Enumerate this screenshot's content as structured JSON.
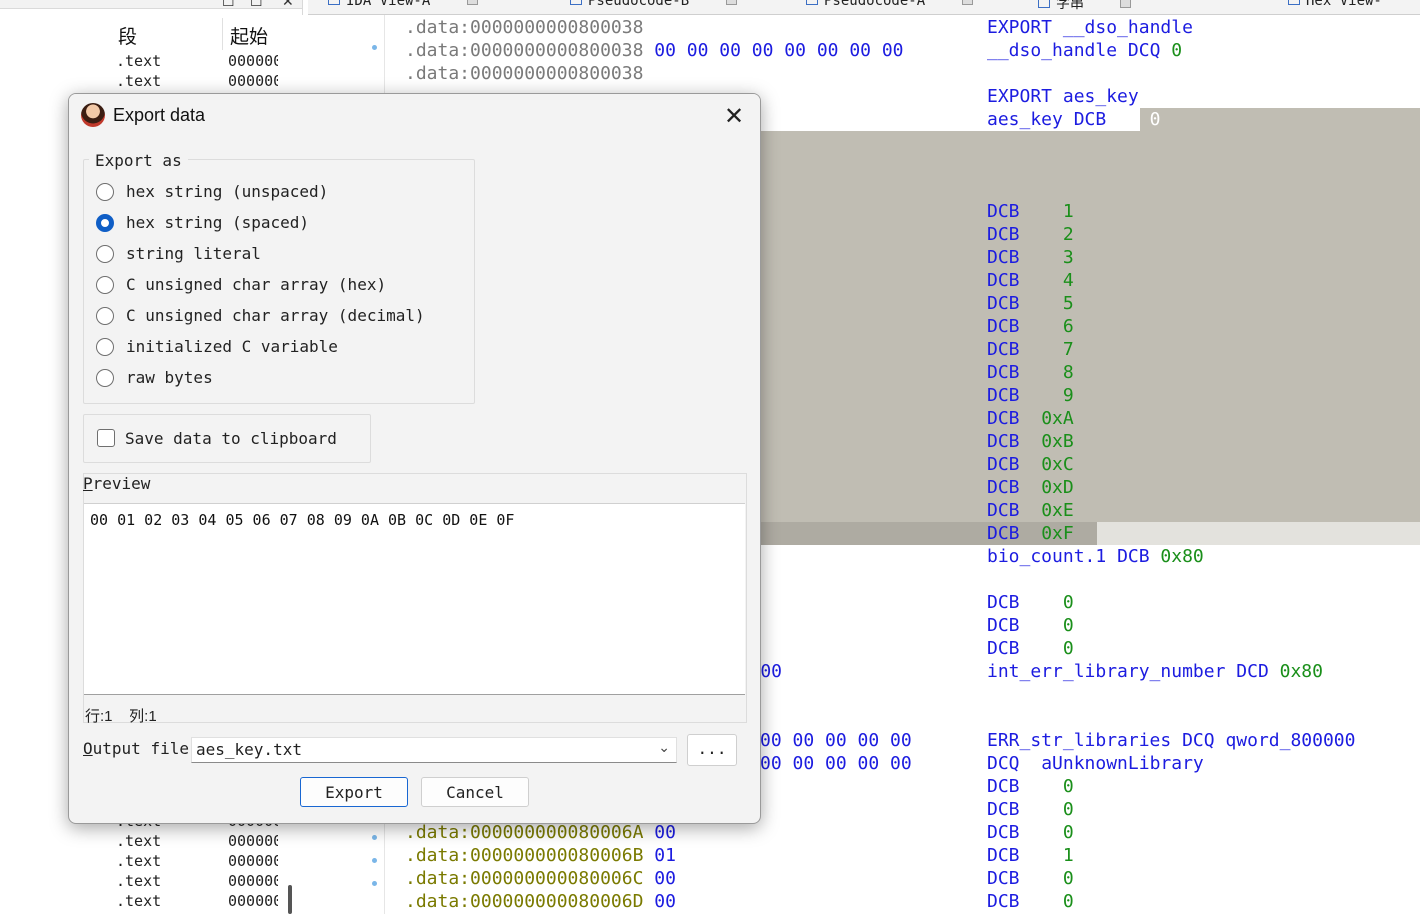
{
  "segments": {
    "headers": [
      "段",
      "起始"
    ],
    "rows_top": [
      {
        "name": ".text",
        "start": "000000"
      },
      {
        "name": ".text",
        "start": "000000"
      }
    ],
    "rows_bottom": [
      {
        "name": ".text",
        "start": "000000"
      },
      {
        "name": ".text",
        "start": "000000"
      },
      {
        "name": ".text",
        "start": "000000"
      },
      {
        "name": ".text",
        "start": "000000"
      },
      {
        "name": ".text",
        "start": "000000"
      }
    ]
  },
  "tabs": [
    {
      "label": "IDA View-A"
    },
    {
      "label": "Pseudocode-B"
    },
    {
      "label": "Pseudocode-A"
    },
    {
      "label": "字串"
    },
    {
      "label": "Hex View-"
    }
  ],
  "listing": {
    "left_top": [
      {
        "addr": ".data:0000000000800038",
        "bytes": ""
      },
      {
        "addr": ".data:0000000000800038",
        "bytes": "00 00 00 00 00 00 00 00"
      },
      {
        "addr": ".data:0000000000800038",
        "bytes": ""
      }
    ],
    "left_mid": [
      {
        "bytes": "00"
      },
      {
        "bytes": "00 00 00 00 00"
      },
      {
        "bytes": "00 00 00 00 00"
      }
    ],
    "left_bottom": [
      {
        "addr": ".data:000000000080006A",
        "bytes": "00"
      },
      {
        "addr": ".data:000000000080006B",
        "bytes": "01"
      },
      {
        "addr": ".data:000000000080006C",
        "bytes": "00"
      },
      {
        "addr": ".data:000000000080006D",
        "bytes": "00"
      }
    ],
    "right": [
      {
        "a": "EXPORT",
        "b": "__dso_handle",
        "c": ""
      },
      {
        "a": "__dso_handle",
        "b": "DCQ",
        "c": "0"
      },
      {
        "a": "",
        "b": "",
        "c": ""
      },
      {
        "a": "EXPORT",
        "b": "aes_key",
        "c": ""
      },
      {
        "a": "aes_key",
        "b": "DCB",
        "c": "0"
      },
      {
        "a": "",
        "b": "",
        "c": ""
      },
      {
        "a": "",
        "b": "",
        "c": ""
      },
      {
        "a": "",
        "b": "",
        "c": ""
      },
      {
        "a": "",
        "b": "DCB",
        "c": "1"
      },
      {
        "a": "",
        "b": "DCB",
        "c": "2"
      },
      {
        "a": "",
        "b": "DCB",
        "c": "3"
      },
      {
        "a": "",
        "b": "DCB",
        "c": "4"
      },
      {
        "a": "",
        "b": "DCB",
        "c": "5"
      },
      {
        "a": "",
        "b": "DCB",
        "c": "6"
      },
      {
        "a": "",
        "b": "DCB",
        "c": "7"
      },
      {
        "a": "",
        "b": "DCB",
        "c": "8"
      },
      {
        "a": "",
        "b": "DCB",
        "c": "9"
      },
      {
        "a": "",
        "b": "DCB",
        "c": "0xA"
      },
      {
        "a": "",
        "b": "DCB",
        "c": "0xB"
      },
      {
        "a": "",
        "b": "DCB",
        "c": "0xC"
      },
      {
        "a": "",
        "b": "DCB",
        "c": "0xD"
      },
      {
        "a": "",
        "b": "DCB",
        "c": "0xE"
      },
      {
        "a": "",
        "b": "DCB",
        "c": "0xF"
      },
      {
        "a": "bio_count.1",
        "b": "DCB",
        "c": "0x80"
      },
      {
        "a": "",
        "b": "",
        "c": ""
      },
      {
        "a": "",
        "b": "DCB",
        "c": "0"
      },
      {
        "a": "",
        "b": "DCB",
        "c": "0"
      },
      {
        "a": "",
        "b": "DCB",
        "c": "0"
      },
      {
        "a": "int_err_library_number",
        "b": "DCD",
        "c": "0x80"
      },
      {
        "a": "",
        "b": "",
        "c": ""
      },
      {
        "a": "",
        "b": "",
        "c": ""
      },
      {
        "a": "ERR_str_libraries",
        "b": "DCQ",
        "c": "qword_800000"
      },
      {
        "a": "",
        "b": "DCQ",
        "c": "aUnknownLibrary"
      },
      {
        "a": "",
        "b": "DCB",
        "c": "0"
      },
      {
        "a": "",
        "b": "DCB",
        "c": "0"
      },
      {
        "a": "",
        "b": "DCB",
        "c": "0"
      },
      {
        "a": "",
        "b": "DCB",
        "c": "1"
      },
      {
        "a": "",
        "b": "DCB",
        "c": "0"
      },
      {
        "a": "",
        "b": "DCB",
        "c": "0"
      }
    ]
  },
  "dialog": {
    "title": "Export data",
    "group_label": "Export as",
    "options": [
      {
        "label": "hex string (unspaced)",
        "checked": false
      },
      {
        "label": "hex string (spaced)",
        "checked": true
      },
      {
        "label": "string literal",
        "checked": false
      },
      {
        "label": "C unsigned char array (hex)",
        "checked": false
      },
      {
        "label": "C unsigned char array (decimal)",
        "checked": false
      },
      {
        "label": "initialized C variable",
        "checked": false
      },
      {
        "label": "raw bytes",
        "checked": false
      }
    ],
    "clipboard_label": "Save data to clipboard",
    "clipboard_checked": false,
    "preview_label_first": "P",
    "preview_label_rest": "review",
    "preview_text": "00 01 02 03 04 05 06 07 08 09 0A 0B 0C 0D 0E 0F",
    "status": "行:1    列:1",
    "output_label_first": "O",
    "output_label_rest": "utput file",
    "output_value": "aes_key.txt",
    "browse_label": "...",
    "export_label": "Export",
    "cancel_label": "Cancel"
  },
  "colors": {
    "accent": "#0f5ec6",
    "highlight": "#c0bdb3",
    "keyword": "#1c1ce0",
    "number": "#1a8f1a"
  }
}
